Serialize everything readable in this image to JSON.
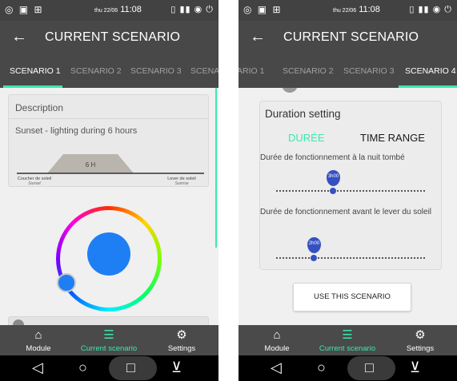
{
  "left": {
    "status": {
      "left_icons": "◎ ▣ ⊞",
      "date": "thu 22/06",
      "time": "11:08",
      "right_icons": "▯ ▮▮ ◉ ⏻"
    },
    "appbar": {
      "title": "CURRENT SCENARIO",
      "back": "←"
    },
    "tabs": [
      "SCENARIO 1",
      "SCENARIO 2",
      "SCENARIO 3",
      "SCENA"
    ],
    "description": {
      "heading": "Description",
      "text": "Sunset - lighting during 6 hours",
      "duration_label": "6 H",
      "left_label": "Coucher de soleil",
      "left_sub": "Sunset",
      "right_label": "Lever de soleil",
      "right_sub": "Sunrise"
    },
    "color": {
      "selected": "#1e7ff5"
    }
  },
  "right": {
    "status": {
      "left_icons": "◎ ▣ ⊞",
      "date": "thu 22/06",
      "time": "11:08",
      "right_icons": "▯ ▮▮ ◉ ⏻"
    },
    "appbar": {
      "title": "CURRENT SCENARIO",
      "back": "←"
    },
    "tabs": [
      "ARIO 1",
      "SCENARIO 2",
      "SCENARIO 3",
      "SCENARIO 4"
    ],
    "duration": {
      "title": "Duration setting",
      "tab_duree": "DURÉE",
      "tab_time_range": "TIME RANGE",
      "label_night": "Durée de fonctionnement à la nuit tombé",
      "night_value": "3h00",
      "night_fraction": 0.38,
      "label_before": "Durée de fonctionnement avant le lever du soleil",
      "before_value": "2h00",
      "before_fraction": 0.25
    },
    "use_button": "USE THIS SCENARIO"
  },
  "nav": {
    "items": [
      {
        "icon": "home-icon",
        "glyph": "⌂",
        "label": "Module"
      },
      {
        "icon": "sliders-icon",
        "glyph": "☰",
        "label": "Current scenario"
      },
      {
        "icon": "gear-icon",
        "glyph": "⚙",
        "label": "Settings"
      }
    ],
    "system": {
      "back": "◁",
      "home": "○",
      "recents": "□",
      "down": "⊻"
    }
  },
  "colors": {
    "accent": "#3be8b0",
    "bar": "#484848",
    "thumb": "#3550c0"
  }
}
